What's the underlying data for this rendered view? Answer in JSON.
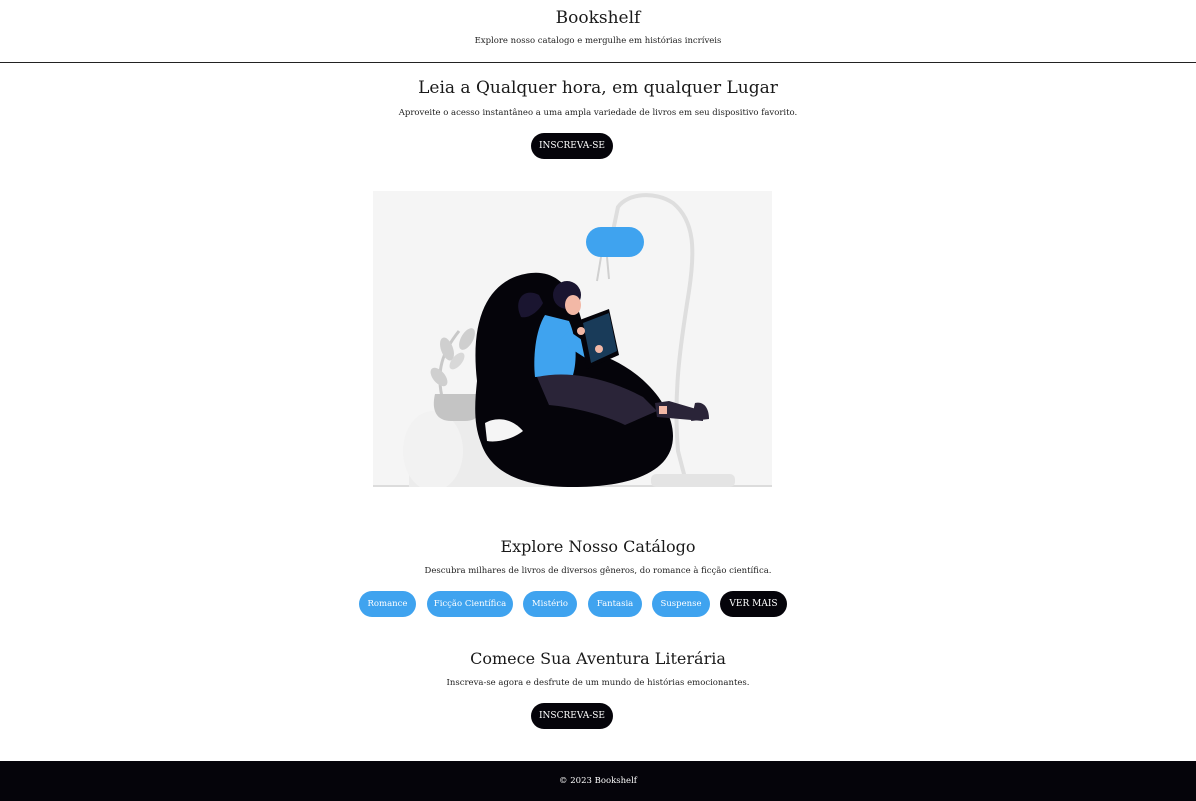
{
  "header": {
    "title": "Bookshelf",
    "subtitle": "Explore nosso catalogo e mergulhe em histórias incríveis"
  },
  "hero": {
    "title": "Leia a Qualquer hora, em qualquer Lugar",
    "text": "Aproveite o acesso instantâneo a uma ampla variedade de livros em seu dispositivo favorito.",
    "button_label": "INSCREVA-SE"
  },
  "catalog": {
    "title": "Explore Nosso Catálogo",
    "text": "Descubra milhares de livros de diversos gêneros, do romance à ficção científica.",
    "genres": [
      "Romance",
      "Ficção Científica",
      "Mistério",
      "Fantasia",
      "Suspense"
    ],
    "more_label": "VER MAIS"
  },
  "adventure": {
    "title": "Comece Sua Aventura Literária",
    "text": "Inscreva-se agora e desfrute de um mundo de histórias emocionantes.",
    "button_label": "INSCREVA-SE"
  },
  "footer": {
    "text": "© 2023 Bookshelf"
  },
  "colors": {
    "accent": "#3fa3ef",
    "dark": "#05040a",
    "background": "#ffffff"
  }
}
